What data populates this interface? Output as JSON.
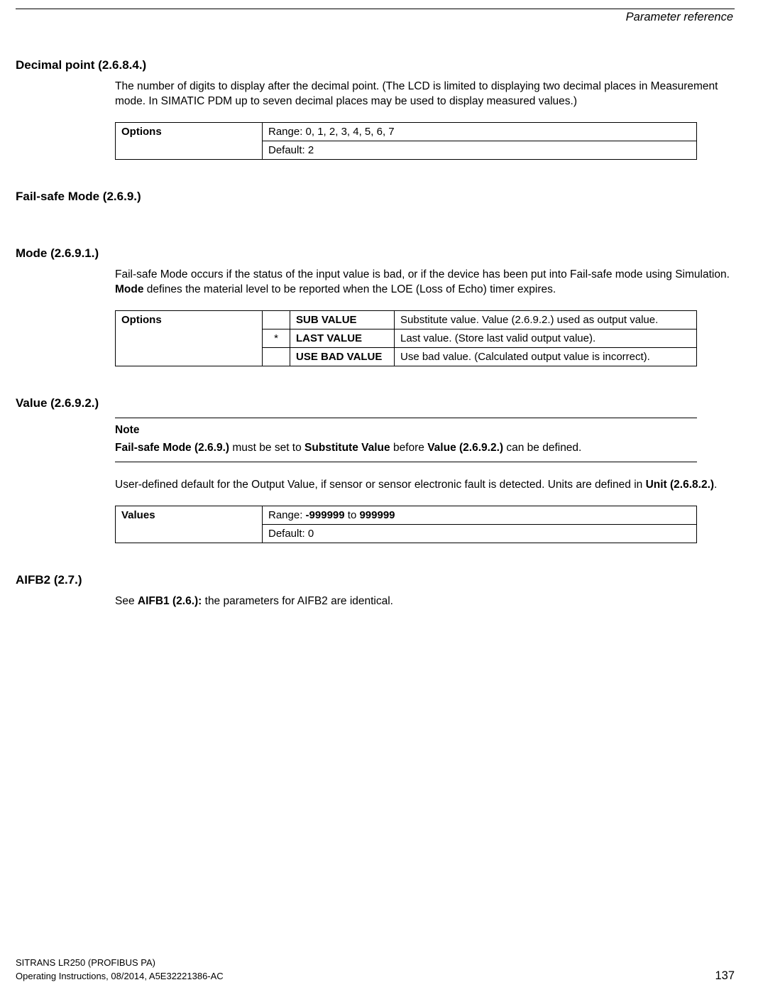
{
  "header": {
    "title": "Parameter reference"
  },
  "sections": {
    "decimal_point": {
      "heading": "Decimal point (2.6.8.4.)",
      "para": "The number of digits to display after the decimal point. (The LCD is limited to displaying two decimal places in Measurement mode. In SIMATIC PDM up to seven decimal places may be used to display measured values.)",
      "table_label": "Options",
      "row1": "Range: 0, 1, 2, 3, 4, 5, 6, 7",
      "row2": "Default: 2"
    },
    "failsafe_mode": {
      "heading": "Fail-safe Mode (2.6.9.)"
    },
    "mode": {
      "heading": "Mode (2.6.9.1.)",
      "para_before": "Fail-safe Mode occurs if the status of the input value is bad, or if the device has been put into Fail-safe mode using Simulation. ",
      "para_bold": "Mode",
      "para_after": " defines the material level to be reported when the LOE (Loss of Echo) timer expires.",
      "table_label": "Options",
      "r1_star": "",
      "r1_name": "SUB VALUE",
      "r1_desc": "Substitute value. Value (2.6.9.2.) used as output value.",
      "r2_star": "*",
      "r2_name": "LAST VALUE",
      "r2_desc": "Last value. (Store last valid output value).",
      "r3_star": "",
      "r3_name": "USE BAD VALUE",
      "r3_desc": "Use bad value. (Calculated output value is incorrect)."
    },
    "value": {
      "heading": "Value (2.6.9.2.)",
      "note_label": "Note",
      "note_b1": "Fail-safe Mode (2.6.9.)",
      "note_t1": " must be set to ",
      "note_b2": "Substitute Value",
      "note_t2": " before ",
      "note_b3": "Value (2.6.9.2.)",
      "note_t3": " can be defined.",
      "para_t1": "User-defined default for the Output Value, if sensor or sensor electronic fault is detected. Units are defined in ",
      "para_b1": "Unit (2.6.8.2.)",
      "para_t2": ".",
      "table_label": "Values",
      "row1_t1": "Range: ",
      "row1_b1": "-999999",
      "row1_t2": " to ",
      "row1_b2": "999999",
      "row2": "Default: 0"
    },
    "aifb2": {
      "heading": "AIFB2 (2.7.)",
      "para_t1": "See ",
      "para_b1": "AIFB1 (2.6.):",
      "para_t2": " the parameters for AIFB2 are identical."
    }
  },
  "footer": {
    "line1": "SITRANS LR250 (PROFIBUS PA)",
    "line2": "Operating Instructions, 08/2014, A5E32221386-AC",
    "page": "137"
  }
}
